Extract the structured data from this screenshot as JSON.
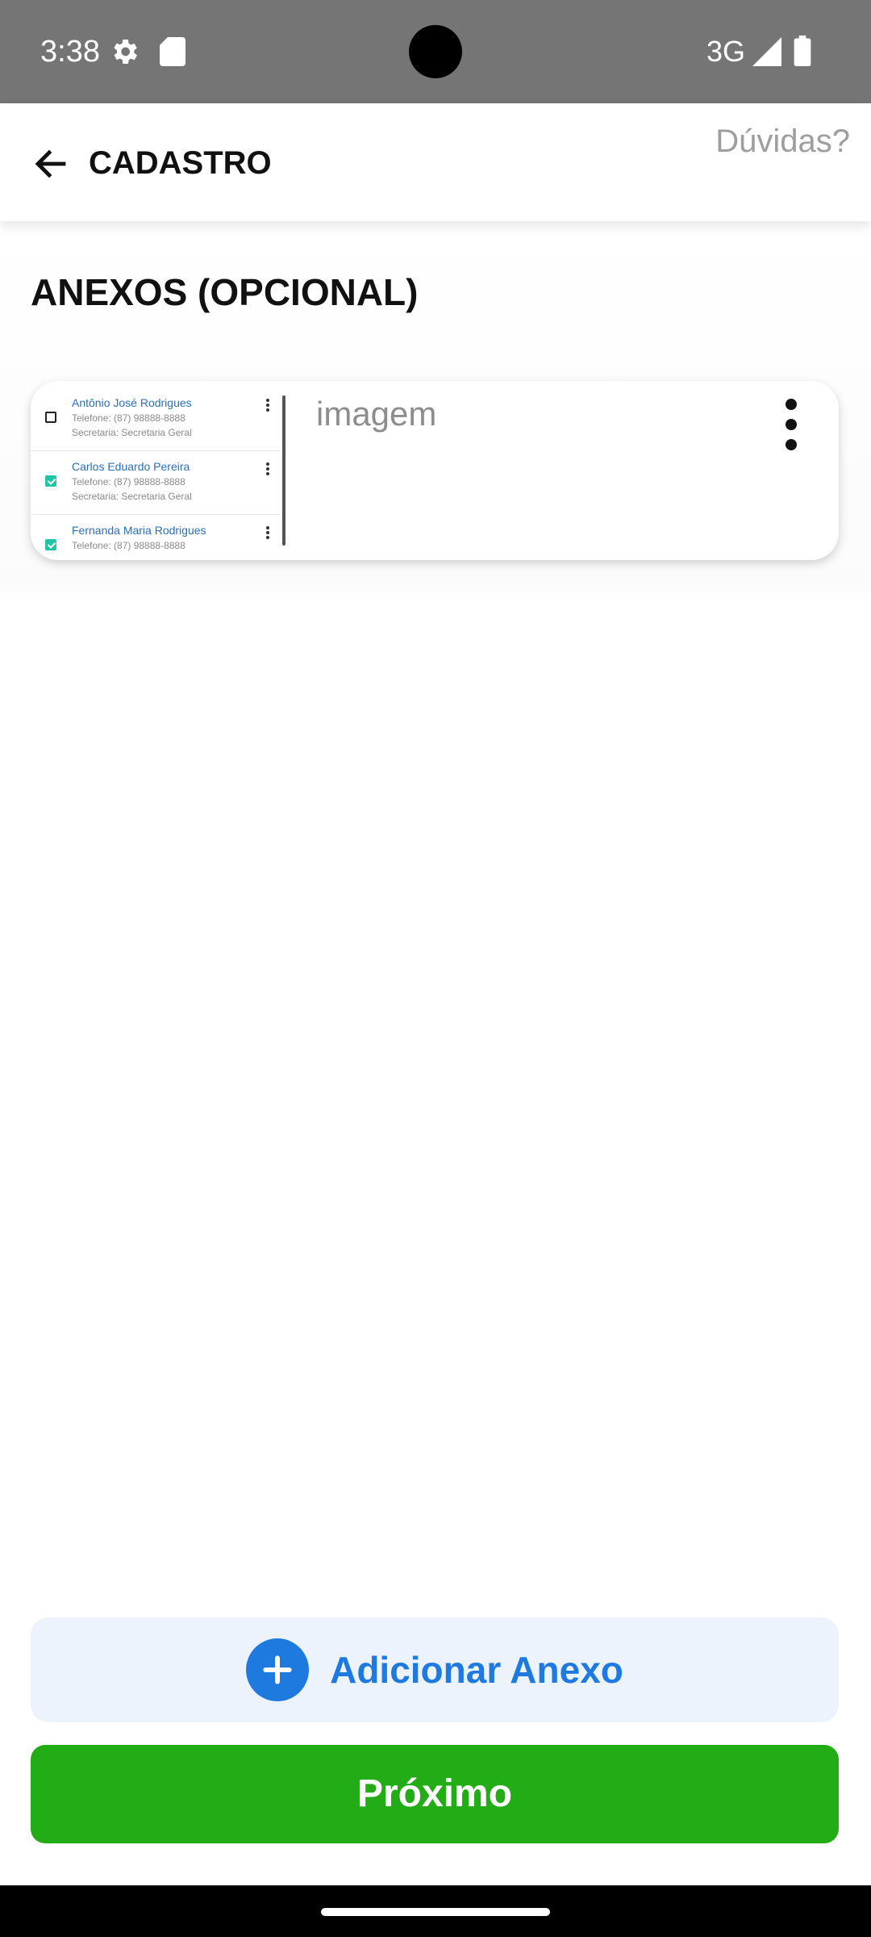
{
  "status_bar": {
    "time": "3:38",
    "network": "3G",
    "icons": [
      "settings-gear-icon",
      "sd-card-icon",
      "signal-icon",
      "battery-icon"
    ]
  },
  "app_bar": {
    "title": "CADASTRO",
    "help_link": "Dúvidas?",
    "back_icon": "arrow-left-icon"
  },
  "section": {
    "title": "ANEXOS (OPCIONAL)"
  },
  "attachments": [
    {
      "name": "imagem",
      "menu_icon": "more-vertical-icon",
      "thumbnail": {
        "rows": [
          {
            "name": "Antônio José Rodrigues",
            "phone": "Telefone: (87) 98888-8888",
            "department": "Secretaria: Secretaria Geral",
            "checked": false
          },
          {
            "name": "Carlos Eduardo Pereira",
            "phone": "Telefone: (87) 98888-8888",
            "department": "Secretaria: Secretaria Geral",
            "checked": true
          },
          {
            "name": "Fernanda Maria Rodrigues",
            "phone": "Telefone: (87) 98888-8888",
            "department": "",
            "checked": true
          }
        ]
      }
    }
  ],
  "actions": {
    "add_attachment_label": "Adicionar Anexo",
    "add_icon": "plus-circle-icon",
    "next_label": "Próximo"
  },
  "colors": {
    "primary_blue": "#1f7ae0",
    "add_button_bg": "#edf3fc",
    "next_button_green": "#22ac16",
    "status_bar_gray": "#757575",
    "check_teal": "#22c4a6",
    "thumbnail_name_blue": "#2a6fb8"
  }
}
